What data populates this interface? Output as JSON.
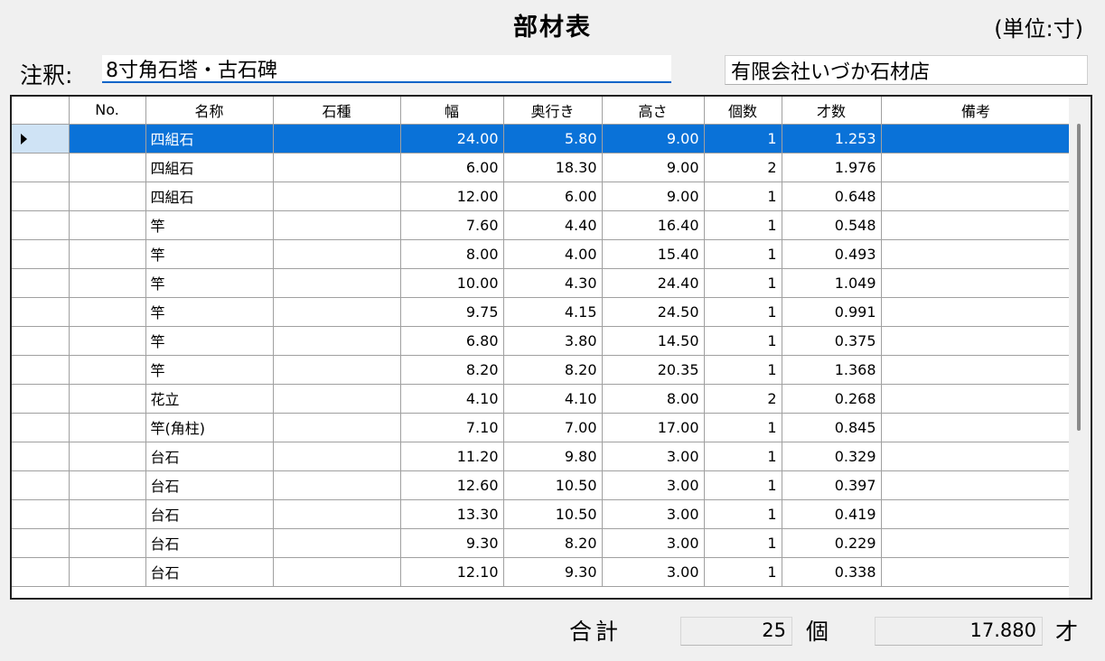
{
  "header": {
    "title": "部材表",
    "unit": "(単位:寸)"
  },
  "note": {
    "label": "注釈:",
    "value": "8寸角石塔・古石碑"
  },
  "company": {
    "value": "有限会社いづか石材店"
  },
  "grid": {
    "columns": [
      "No.",
      "名称",
      "石種",
      "幅",
      "奥行き",
      "高さ",
      "個数",
      "才数",
      "備考"
    ],
    "rows": [
      {
        "no": "",
        "name": "四組石",
        "stone": "",
        "width": "24.00",
        "depth": "5.80",
        "height": "9.00",
        "count": "1",
        "sai": "1.253",
        "remarks": ""
      },
      {
        "no": "",
        "name": "四組石",
        "stone": "",
        "width": "6.00",
        "depth": "18.30",
        "height": "9.00",
        "count": "2",
        "sai": "1.976",
        "remarks": ""
      },
      {
        "no": "",
        "name": "四組石",
        "stone": "",
        "width": "12.00",
        "depth": "6.00",
        "height": "9.00",
        "count": "1",
        "sai": "0.648",
        "remarks": ""
      },
      {
        "no": "",
        "name": "竿",
        "stone": "",
        "width": "7.60",
        "depth": "4.40",
        "height": "16.40",
        "count": "1",
        "sai": "0.548",
        "remarks": ""
      },
      {
        "no": "",
        "name": "竿",
        "stone": "",
        "width": "8.00",
        "depth": "4.00",
        "height": "15.40",
        "count": "1",
        "sai": "0.493",
        "remarks": ""
      },
      {
        "no": "",
        "name": "竿",
        "stone": "",
        "width": "10.00",
        "depth": "4.30",
        "height": "24.40",
        "count": "1",
        "sai": "1.049",
        "remarks": ""
      },
      {
        "no": "",
        "name": "竿",
        "stone": "",
        "width": "9.75",
        "depth": "4.15",
        "height": "24.50",
        "count": "1",
        "sai": "0.991",
        "remarks": ""
      },
      {
        "no": "",
        "name": "竿",
        "stone": "",
        "width": "6.80",
        "depth": "3.80",
        "height": "14.50",
        "count": "1",
        "sai": "0.375",
        "remarks": ""
      },
      {
        "no": "",
        "name": "竿",
        "stone": "",
        "width": "8.20",
        "depth": "8.20",
        "height": "20.35",
        "count": "1",
        "sai": "1.368",
        "remarks": ""
      },
      {
        "no": "",
        "name": "花立",
        "stone": "",
        "width": "4.10",
        "depth": "4.10",
        "height": "8.00",
        "count": "2",
        "sai": "0.268",
        "remarks": ""
      },
      {
        "no": "",
        "name": "竿(角柱)",
        "stone": "",
        "width": "7.10",
        "depth": "7.00",
        "height": "17.00",
        "count": "1",
        "sai": "0.845",
        "remarks": ""
      },
      {
        "no": "",
        "name": "台石",
        "stone": "",
        "width": "11.20",
        "depth": "9.80",
        "height": "3.00",
        "count": "1",
        "sai": "0.329",
        "remarks": ""
      },
      {
        "no": "",
        "name": "台石",
        "stone": "",
        "width": "12.60",
        "depth": "10.50",
        "height": "3.00",
        "count": "1",
        "sai": "0.397",
        "remarks": ""
      },
      {
        "no": "",
        "name": "台石",
        "stone": "",
        "width": "13.30",
        "depth": "10.50",
        "height": "3.00",
        "count": "1",
        "sai": "0.419",
        "remarks": ""
      },
      {
        "no": "",
        "name": "台石",
        "stone": "",
        "width": "9.30",
        "depth": "8.20",
        "height": "3.00",
        "count": "1",
        "sai": "0.229",
        "remarks": ""
      },
      {
        "no": "",
        "name": "台石",
        "stone": "",
        "width": "12.10",
        "depth": "9.30",
        "height": "3.00",
        "count": "1",
        "sai": "0.338",
        "remarks": ""
      }
    ],
    "selected_row": 0
  },
  "totals": {
    "label": "合計",
    "count": "25",
    "count_unit": "個",
    "sai": "17.880",
    "sai_unit": "才"
  },
  "colors": {
    "selection": "#0a72d8",
    "input_underline": "#0a64c8"
  }
}
